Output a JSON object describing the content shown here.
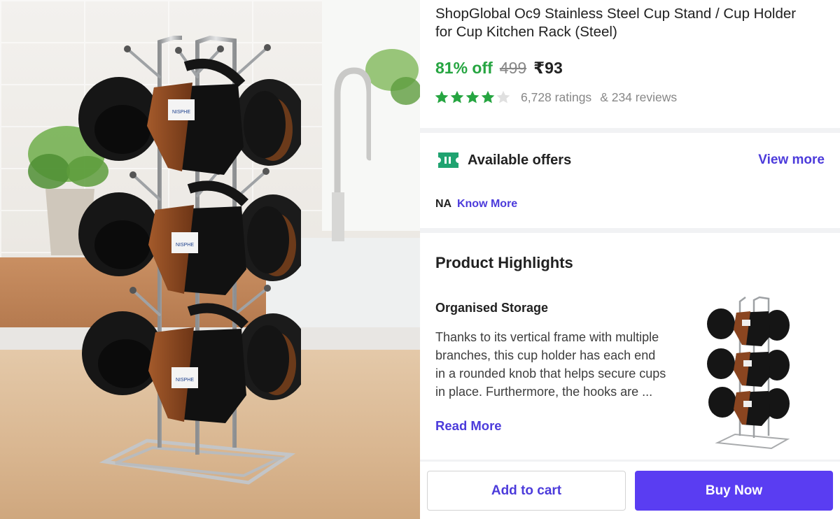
{
  "product": {
    "title": "ShopGlobal Oc9 Stainless Steel Cup Stand / Cup Holder for Cup Kitchen Rack (Steel)",
    "discount": "81% off",
    "mrp": "499",
    "price": "₹93",
    "rating_stars": 4,
    "ratings": "6,728 ratings",
    "reviews": "& 234 reviews",
    "mug_label": "NISPHE"
  },
  "offers": {
    "icon": "offer-ticket-icon",
    "title": "Available offers",
    "view_more": "View more",
    "na": "NA",
    "know_more": "Know More"
  },
  "highlights": {
    "title": "Product Highlights",
    "subtitle": "Organised Storage",
    "description": "Thanks to its vertical frame with multiple branches, this cup holder has each end in a rounded knob that helps secure cups in place. Furthermore, the hooks are ...",
    "read_more": "Read More"
  },
  "actions": {
    "add_to_cart": "Add to cart",
    "buy_now": "Buy Now"
  },
  "colors": {
    "accent": "#4c3bdb",
    "buy_button": "#5a3df2",
    "discount_green": "#26a541",
    "star_green": "#26a541"
  }
}
